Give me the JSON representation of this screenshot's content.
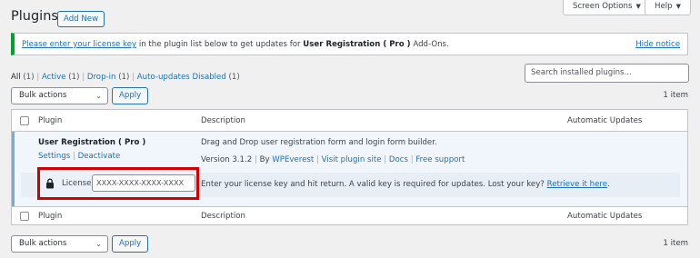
{
  "header": {
    "screen_options_label": "Screen Options",
    "help_label": "Help",
    "title": "Plugins",
    "add_new_label": "Add New"
  },
  "notice": {
    "link_text": "Please enter your license key",
    "text_before_plugin": " in the plugin list below to get updates for ",
    "plugin_name": "User Registration ( Pro )",
    "text_after": " Add-Ons.",
    "hide_label": "Hide notice"
  },
  "filters": {
    "items": [
      {
        "label": "All",
        "count": "(1)"
      },
      {
        "label": "Active",
        "count": "(1)"
      },
      {
        "label": "Drop-in",
        "count": "(1)"
      },
      {
        "label": "Auto-updates Disabled",
        "count": "(1)"
      }
    ],
    "separator": "|"
  },
  "search": {
    "placeholder": "Search installed plugins..."
  },
  "bulk": {
    "top_select": "Bulk actions",
    "apply_label": "Apply",
    "items_count": "1 item",
    "bottom_select": "Bulk actions",
    "bottom_apply_label": "Apply",
    "bottom_items_count": "1 item"
  },
  "table": {
    "columns": {
      "plugin": "Plugin",
      "description": "Description",
      "auto_updates": "Automatic Updates"
    },
    "plugin": {
      "name": "User Registration ( Pro )",
      "settings_label": "Settings",
      "deactivate_label": "Deactivate",
      "description": "Drag and Drop user registration form and login form builder.",
      "version": "Version 3.1.2",
      "by": "By",
      "author": "WPEverest",
      "visit_site": "Visit plugin site",
      "docs": "Docs",
      "free_support": "Free support"
    },
    "license": {
      "label": "License:",
      "placeholder": "XXXX-XXXX-XXXX-XXXX",
      "help_text": "Enter your license key and hit return. A valid key is required for updates. Lost your key?",
      "retrieve_link": "Retrieve it here",
      "retrieve_suffix": "."
    }
  },
  "colors": {
    "link": "#2271b1",
    "notice_accent": "#00a32a",
    "highlight": "#d00000"
  }
}
